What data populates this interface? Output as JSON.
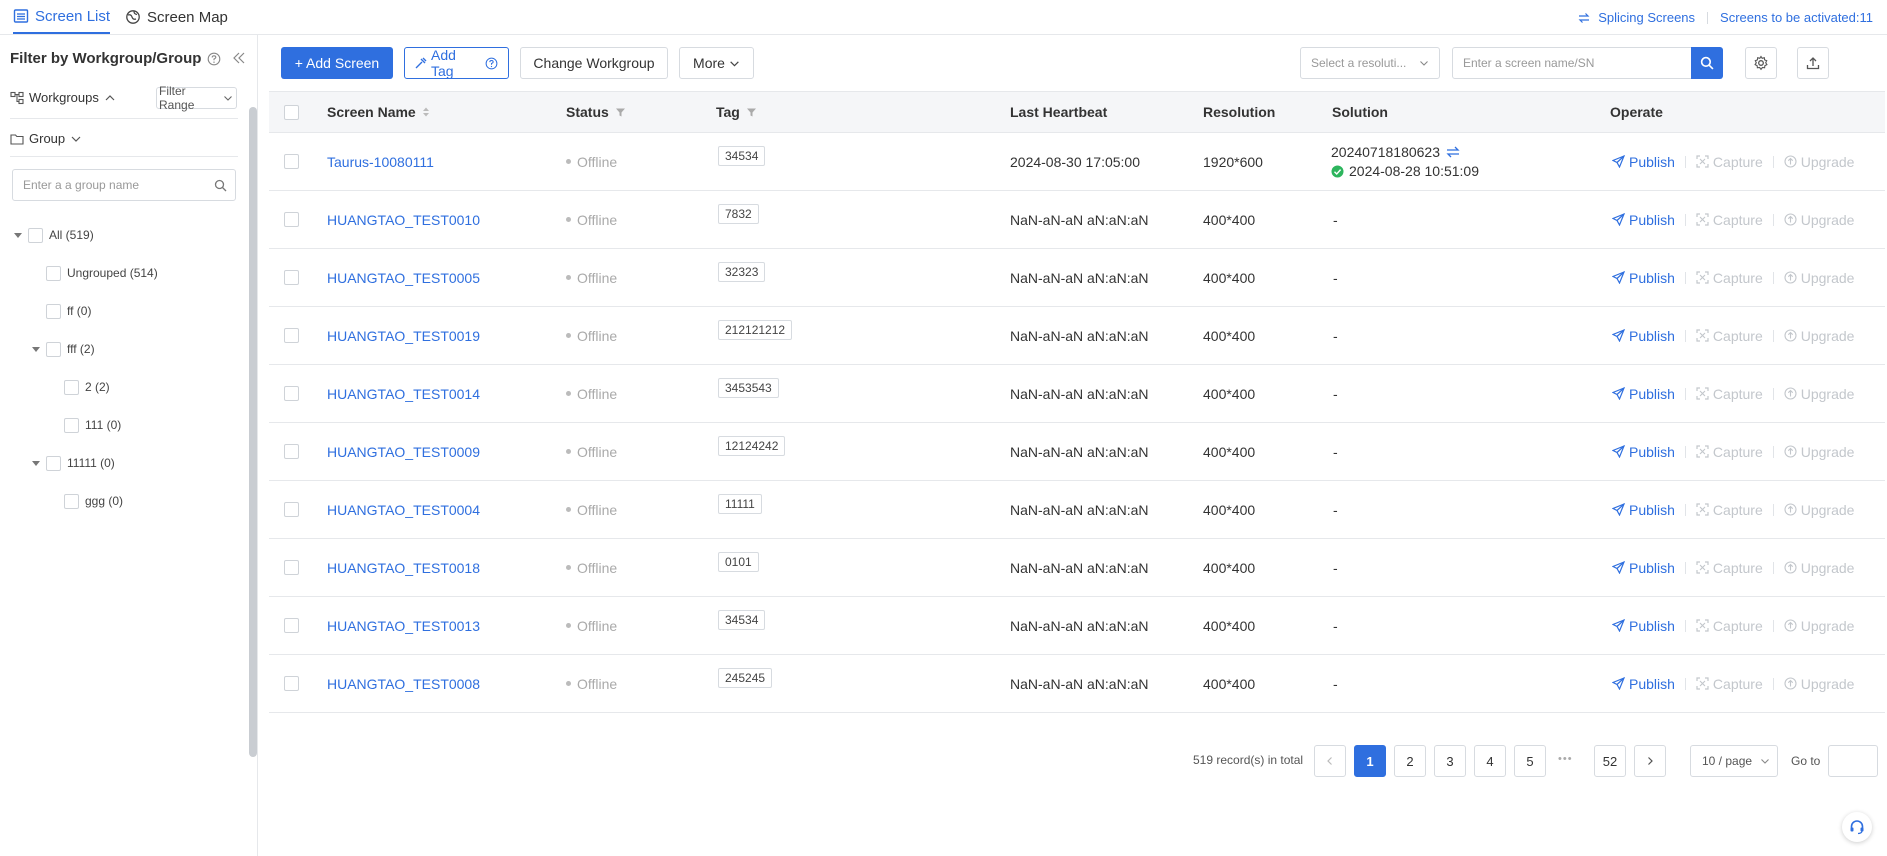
{
  "top_tabs": [
    {
      "label": "Screen List",
      "icon": "list-icon"
    },
    {
      "label": "Screen Map",
      "icon": "globe-icon"
    }
  ],
  "top_right": {
    "splicing": "Splicing Screens",
    "to_activate": "Screens to be activated:11"
  },
  "sidebar": {
    "title": "Filter by Workgroup/Group",
    "workgroups_label": "Workgroups",
    "filter_range": "Filter Range",
    "group_label": "Group",
    "search_placeholder": "Enter a a group name",
    "tree": [
      {
        "label": "All (519)"
      },
      {
        "label": "Ungrouped (514)"
      },
      {
        "label": "ff (0)"
      },
      {
        "label": "fff (2)"
      },
      {
        "label": "2 (2)"
      },
      {
        "label": "111 (0)"
      },
      {
        "label": "11111 (0)"
      },
      {
        "label": "ggg (0)"
      }
    ]
  },
  "toolbar": {
    "add_screen": "+ Add Screen",
    "add_tag": "Add Tag",
    "change_workgroup": "Change Workgroup",
    "more": "More",
    "resolution_placeholder": "Select a resoluti...",
    "search_placeholder": "Enter a screen name/SN"
  },
  "table": {
    "headers": [
      "Screen Name",
      "Status",
      "Tag",
      "Last Heartbeat",
      "Resolution",
      "Solution",
      "Operate"
    ],
    "ops": [
      "Publish",
      "Capture",
      "Upgrade"
    ],
    "rows": [
      {
        "name": "Taurus-10080111",
        "status": "Offline",
        "tag": "34534",
        "heartbeat": "2024-08-30 17:05:00",
        "resolution": "1920*600",
        "solution": "20240718180623",
        "solution_time": "2024-08-28 10:51:09"
      },
      {
        "name": "HUANGTAO_TEST0010",
        "status": "Offline",
        "tag": "7832",
        "heartbeat": "NaN-aN-aN aN:aN:aN",
        "resolution": "400*400",
        "solution": "-"
      },
      {
        "name": "HUANGTAO_TEST0005",
        "status": "Offline",
        "tag": "32323",
        "heartbeat": "NaN-aN-aN aN:aN:aN",
        "resolution": "400*400",
        "solution": "-"
      },
      {
        "name": "HUANGTAO_TEST0019",
        "status": "Offline",
        "tag": "212121212",
        "heartbeat": "NaN-aN-aN aN:aN:aN",
        "resolution": "400*400",
        "solution": "-"
      },
      {
        "name": "HUANGTAO_TEST0014",
        "status": "Offline",
        "tag": "3453543",
        "heartbeat": "NaN-aN-aN aN:aN:aN",
        "resolution": "400*400",
        "solution": "-"
      },
      {
        "name": "HUANGTAO_TEST0009",
        "status": "Offline",
        "tag": "12124242",
        "heartbeat": "NaN-aN-aN aN:aN:aN",
        "resolution": "400*400",
        "solution": "-"
      },
      {
        "name": "HUANGTAO_TEST0004",
        "status": "Offline",
        "tag": "11111",
        "heartbeat": "NaN-aN-aN aN:aN:aN",
        "resolution": "400*400",
        "solution": "-"
      },
      {
        "name": "HUANGTAO_TEST0018",
        "status": "Offline",
        "tag": "0101",
        "heartbeat": "NaN-aN-aN aN:aN:aN",
        "resolution": "400*400",
        "solution": "-"
      },
      {
        "name": "HUANGTAO_TEST0013",
        "status": "Offline",
        "tag": "34534",
        "heartbeat": "NaN-aN-aN aN:aN:aN",
        "resolution": "400*400",
        "solution": "-"
      },
      {
        "name": "HUANGTAO_TEST0008",
        "status": "Offline",
        "tag": "245245",
        "heartbeat": "NaN-aN-aN aN:aN:aN",
        "resolution": "400*400",
        "solution": "-"
      }
    ]
  },
  "pagination": {
    "total": "519 record(s) in total",
    "pages": [
      "1",
      "2",
      "3",
      "4",
      "5"
    ],
    "ellipsis": "•••",
    "last": "52",
    "page_size": "10 / page",
    "goto": "Go to"
  },
  "colors": {
    "accent": "#2f6fdf",
    "success": "#2db55d",
    "muted": "#c3c7cc"
  }
}
